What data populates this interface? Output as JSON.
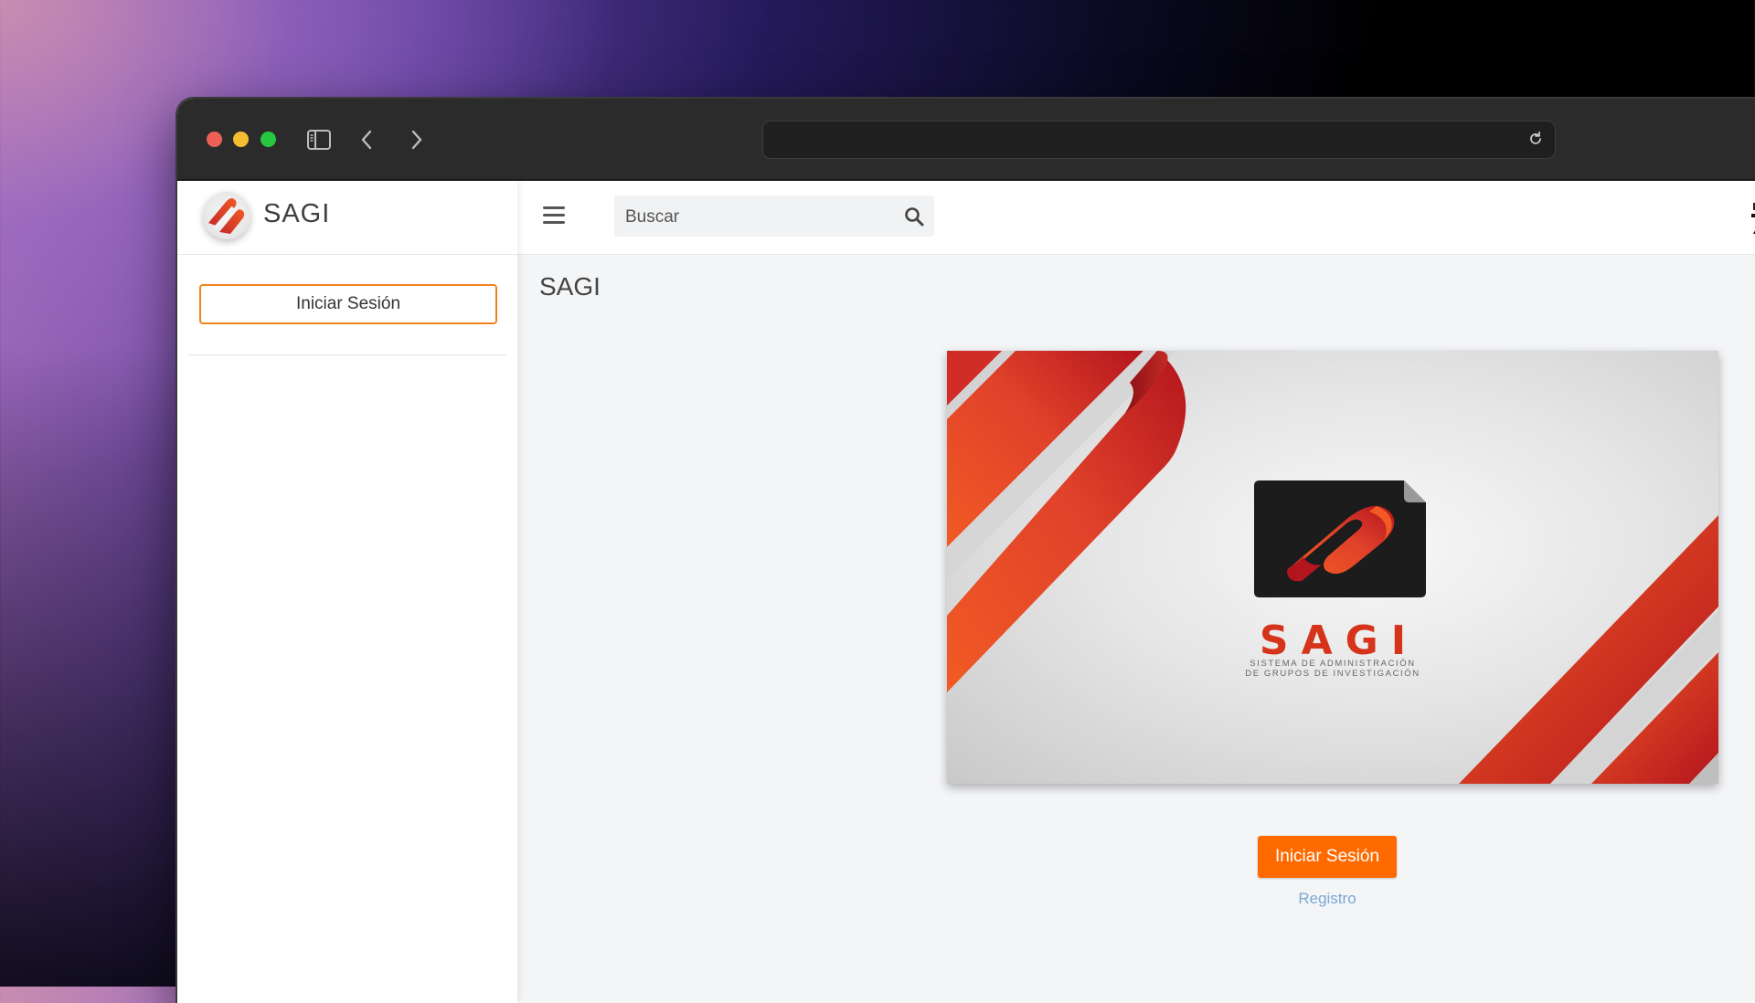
{
  "browser": {
    "address_text": ""
  },
  "sidebar": {
    "brand_name": "SAGI",
    "login_label": "Iniciar Sesión"
  },
  "topbar": {
    "search_placeholder": "Buscar"
  },
  "main": {
    "page_title": "SAGI",
    "banner": {
      "title": "SAGI",
      "subtitle_line1": "SISTEMA DE ADMINISTRACIÓN",
      "subtitle_line2": "DE GRUPOS DE INVESTIGACIÓN"
    },
    "login_button_label": "Iniciar Sesión",
    "register_link_label": "Registro"
  },
  "colors": {
    "accent_orange": "#ff6a00",
    "login_border": "#f0821e",
    "brand_red": "#d6331b",
    "link_blue": "#7aa8d4"
  },
  "icons": {
    "sidebar_toggle": "sidebar-icon",
    "back": "chevron-left-icon",
    "forward": "chevron-right-icon",
    "reload": "reload-icon",
    "menu": "hamburger-icon",
    "search": "search-icon"
  }
}
